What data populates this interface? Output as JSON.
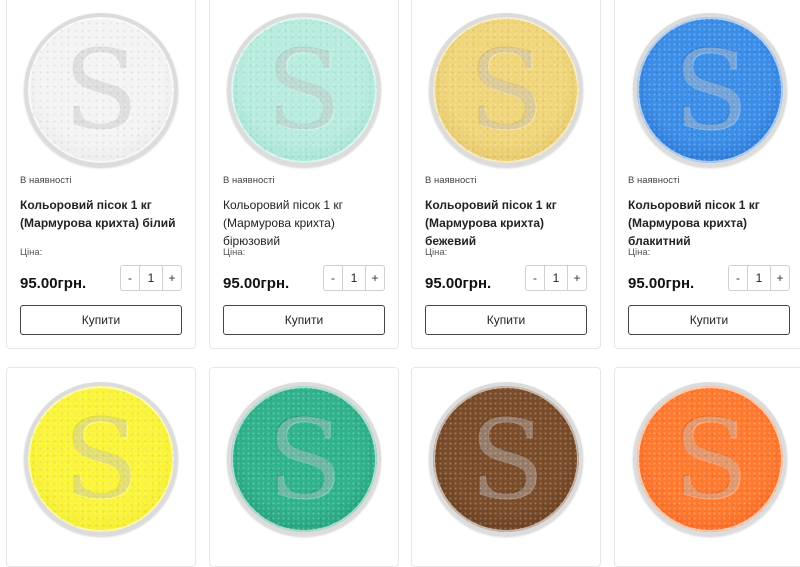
{
  "products": [
    {
      "stock": "В наявності",
      "title": "Кольоровий пісок 1 кг (Мармурова крихта) білий",
      "price_label": "Ціна:",
      "price": "95.00грн.",
      "qty": "1",
      "minus": "-",
      "plus": "+",
      "buy": "Купити",
      "colors": {
        "center": "#f4f4f4",
        "edge": "#e2e2e2"
      }
    },
    {
      "stock": "В наявності",
      "title": "Кольоровий пісок 1 кг (Мармурова крихта) бірюзовий",
      "price_label": "Ціна:",
      "price": "95.00грн.",
      "qty": "1",
      "minus": "-",
      "plus": "+",
      "buy": "Купити",
      "colors": {
        "center": "#b8ecdf",
        "edge": "#8fd9c6"
      }
    },
    {
      "stock": "В наявності",
      "title": "Кольоровий пісок 1 кг (Мармурова крихта) бежевий",
      "price_label": "Ціна:",
      "price": "95.00грн.",
      "qty": "1",
      "minus": "-",
      "plus": "+",
      "buy": "Купити",
      "colors": {
        "center": "#f0d579",
        "edge": "#dcb95a"
      }
    },
    {
      "stock": "В наявності",
      "title": "Кольоровий пісок 1 кг (Мармурова крихта) блакитний",
      "price_label": "Ціна:",
      "price": "95.00грн.",
      "qty": "1",
      "minus": "-",
      "plus": "+",
      "buy": "Купити",
      "colors": {
        "center": "#3b8ee8",
        "edge": "#1d63c8"
      }
    },
    {
      "colors": {
        "center": "#fbf53a",
        "edge": "#ece321"
      }
    },
    {
      "colors": {
        "center": "#2fb38c",
        "edge": "#1b8f6c"
      }
    },
    {
      "colors": {
        "center": "#7a4c2a",
        "edge": "#593418"
      }
    },
    {
      "colors": {
        "center": "#ff7a2e",
        "edge": "#f15a1a"
      }
    }
  ]
}
